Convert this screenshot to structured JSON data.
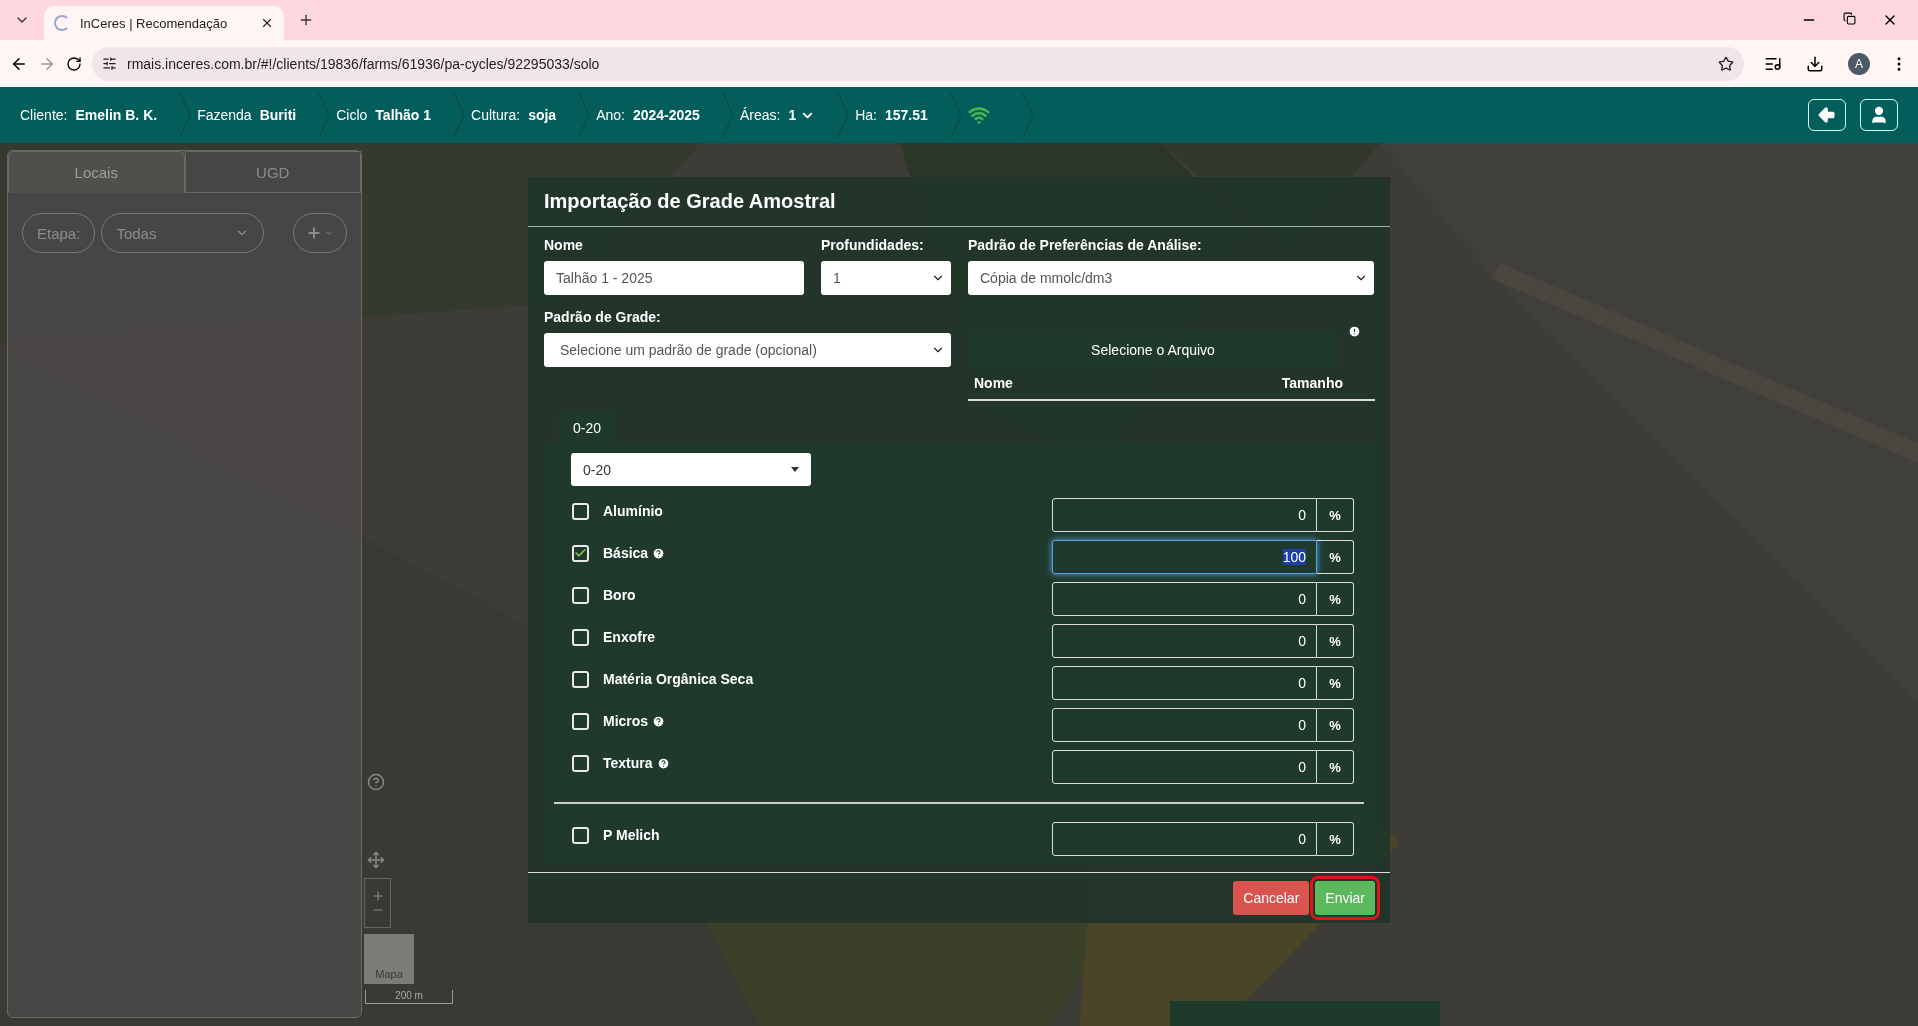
{
  "browser": {
    "tabs": [
      {
        "title": "InCeres | Recomendação",
        "selected": true
      }
    ],
    "url": "rmais.inceres.com.br/#!/clients/19836/farms/61936/pa-cycles/92295033/solo",
    "profile": "A"
  },
  "header": {
    "crumbs": [
      {
        "label": "Cliente:",
        "value": "Emelin B. K.",
        "kind": "text"
      },
      {
        "label": "Fazenda",
        "value": "Buriti",
        "kind": "text"
      },
      {
        "label": "Ciclo",
        "value": "Talhão 1",
        "kind": "text"
      },
      {
        "label": "Cultura:",
        "value": "soja",
        "kind": "text"
      },
      {
        "label": "Ano:",
        "value": "2024-2025",
        "kind": "text"
      },
      {
        "label": "Áreas:",
        "value": "1",
        "kind": "dropdown"
      },
      {
        "label": "Ha:",
        "value": "157.51",
        "kind": "text"
      },
      {
        "kind": "signal"
      }
    ]
  },
  "sidebar": {
    "tabs": [
      {
        "label": "Locais",
        "selected": true
      },
      {
        "label": "UGD",
        "selected": false
      }
    ],
    "filter_label": "Etapa:",
    "filter_value": "Todas"
  },
  "map": {
    "layer": "Mapa",
    "scale": "200 m"
  },
  "dialog": {
    "title": "Importação de Grade Amostral",
    "name": {
      "label": "Nome",
      "value": "Talhão 1 - 2025"
    },
    "depths": {
      "label": "Profundidades:",
      "value": "1"
    },
    "preferences": {
      "label": "Padrão de Preferências de Análise:",
      "value": "Cópia de mmolc/dm3"
    },
    "grid": {
      "label": "Padrão de Grade:",
      "value": "Selecione um padrão de grade (opcional)"
    },
    "file_button": "Selecione o Arquivo",
    "file_columns": [
      "Nome",
      "Tamanho"
    ],
    "depth_tabs": [
      {
        "label": "0-20",
        "selected": true
      }
    ],
    "depth_select": "0-20",
    "analyses": [
      {
        "name": "Alumínio",
        "checked": false,
        "help": false,
        "value": "0",
        "unit": "%",
        "focused": false
      },
      {
        "name": "Básica",
        "checked": true,
        "help": true,
        "value": "100",
        "unit": "%",
        "focused": true
      },
      {
        "name": "Boro",
        "checked": false,
        "help": false,
        "value": "0",
        "unit": "%",
        "focused": false
      },
      {
        "name": "Enxofre",
        "checked": false,
        "help": false,
        "value": "0",
        "unit": "%",
        "focused": false
      },
      {
        "name": "Matéria Orgânica Seca",
        "checked": false,
        "help": false,
        "value": "0",
        "unit": "%",
        "focused": false
      },
      {
        "name": "Micros",
        "checked": false,
        "help": true,
        "value": "0",
        "unit": "%",
        "focused": false
      },
      {
        "name": "Textura",
        "checked": false,
        "help": true,
        "value": "0",
        "unit": "%",
        "focused": false
      }
    ],
    "extra_analyses": [
      {
        "name": "P Melich",
        "checked": false,
        "help": false,
        "value": "0",
        "unit": "%",
        "focused": false
      }
    ],
    "buttons": [
      {
        "label": "Cancelar",
        "kind": "cancel",
        "highlighted": false
      },
      {
        "label": "Enviar",
        "kind": "submit",
        "highlighted": true
      }
    ]
  }
}
